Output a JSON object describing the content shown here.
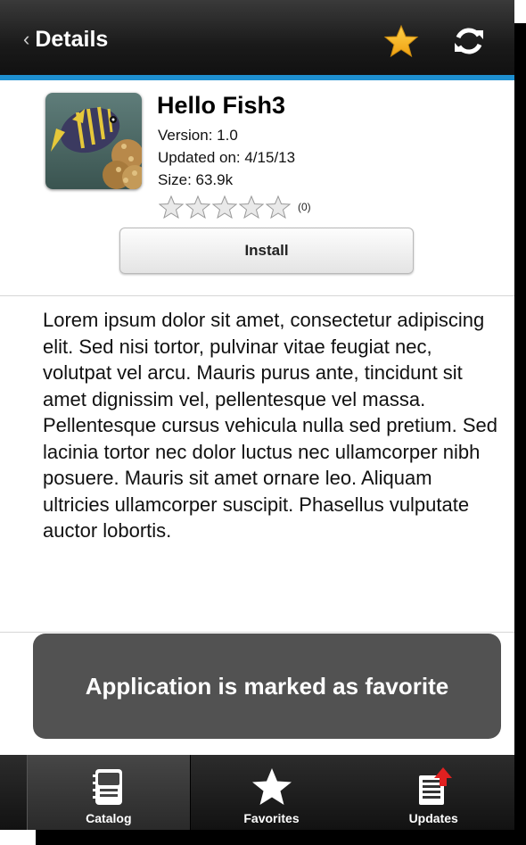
{
  "header": {
    "back_label": "Details",
    "star_icon": "star-icon",
    "refresh_icon": "refresh-icon",
    "accent_color": "#1e8fd0"
  },
  "app": {
    "title": "Hello Fish3",
    "version": "Version: 1.0",
    "updated": "Updated on: 4/15/13",
    "size": "Size: 63.9k",
    "rating_count": "(0)",
    "rating": 0,
    "rating_max": 5,
    "install_label": "Install"
  },
  "description": "Lorem ipsum dolor sit amet, consectetur adipiscing elit. Sed nisi tortor, pulvinar vitae feugiat nec, volutpat vel arcu. Mauris purus ante, tincidunt sit amet dignissim vel, pellentesque vel massa. Pellentesque cursus vehicula nulla sed pretium. Sed lacinia tortor nec dolor luctus nec ullamcorper nibh posuere. Mauris sit amet ornare leo. Aliquam ultricies ullamcorper suscipit. Phasellus vulputate auctor lobortis.",
  "toast": {
    "message": "Application is marked as favorite"
  },
  "tabs": [
    {
      "label": "Catalog",
      "icon": "catalog-icon",
      "active": true
    },
    {
      "label": "Favorites",
      "icon": "favorites-star-icon",
      "active": false
    },
    {
      "label": "Updates",
      "icon": "updates-icon",
      "active": false
    }
  ]
}
